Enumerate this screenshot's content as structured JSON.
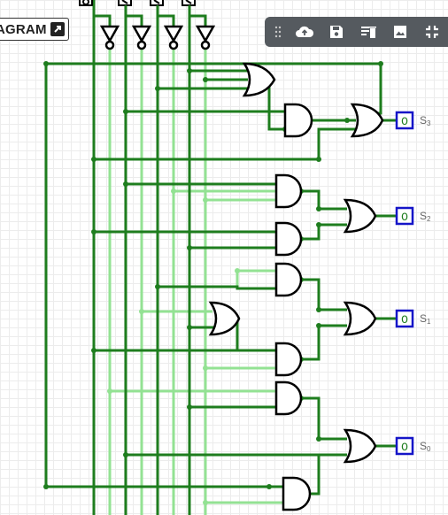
{
  "badge": {
    "label": "AGRAM"
  },
  "toolbar": {
    "icons": [
      "drag-handle-icon",
      "cloud-upload-icon",
      "save-icon",
      "clear-icon",
      "image-icon",
      "fullscreen-exit-icon"
    ]
  },
  "outputs": [
    {
      "symbol": "O",
      "name": "S",
      "sub": "3"
    },
    {
      "symbol": "O",
      "name": "S",
      "sub": "2"
    },
    {
      "symbol": "O",
      "name": "S",
      "sub": "1"
    },
    {
      "symbol": "O",
      "name": "S",
      "sub": "0"
    }
  ],
  "colors": {
    "wire_on": "#1e7d1e",
    "wire_off": "#93e293",
    "gate": "#000000",
    "output_box": "#1515c8",
    "toolbar": "#555a5f"
  }
}
